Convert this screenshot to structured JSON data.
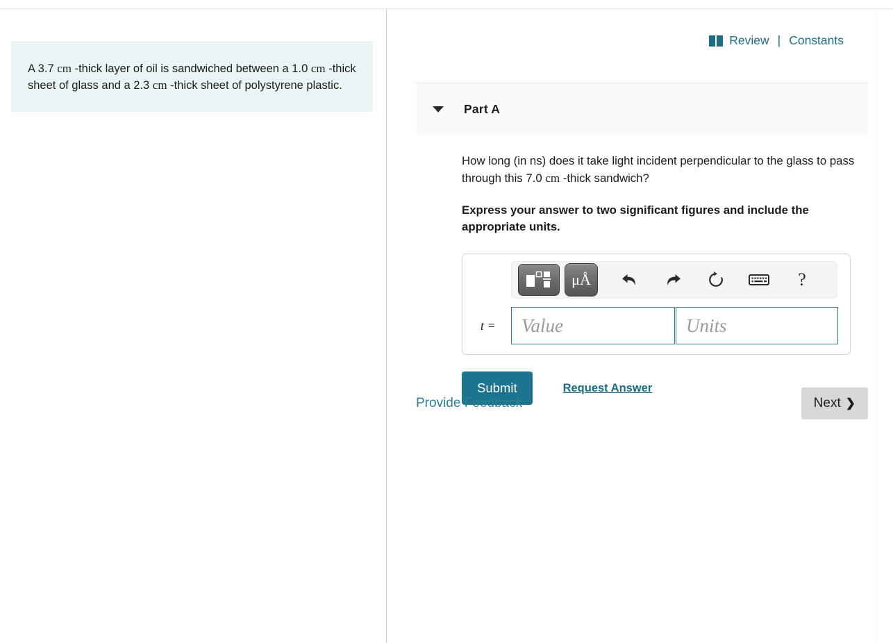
{
  "header": {
    "review_label": "Review",
    "separator": "|",
    "constants_label": "Constants",
    "book_icon": "book-icon",
    "link_color": "#1a6e84"
  },
  "left_pane": {
    "problem_statement": {
      "segment_1": "A 3.7 ",
      "unit_1": "cm",
      "segment_2": " -thick layer of oil is sandwiched between a 1.0 ",
      "unit_2": "cm",
      "segment_3": " -thick sheet of glass and a 2.3 ",
      "unit_3": "cm",
      "segment_4": " -thick sheet of polystyrene plastic.",
      "background_color": "#e9f4f4"
    }
  },
  "part": {
    "title": "Part A",
    "caret_icon": "chevron-down-icon",
    "question_segment_1": "How long (in ns) does it take light incident perpendicular to the glass to pass through this 7.0 ",
    "question_unit": "cm",
    "question_segment_2": " -thick sandwich?",
    "instruction": "Express your answer to two significant figures and include the appropriate units."
  },
  "answer_widget": {
    "template_button_icon": "math-template-icon",
    "unit_button_label": "μÅ",
    "unit_button_icon": "unit-prefix-icon",
    "undo_icon": "undo-icon",
    "redo_icon": "redo-icon",
    "reset_icon": "reset-icon",
    "keyboard_icon": "keyboard-icon",
    "help_icon": "?",
    "variable_label": "t =",
    "value_placeholder": "Value",
    "units_placeholder": "Units",
    "value_current": "",
    "units_current": "",
    "field_border_color": "#2c7f92"
  },
  "actions": {
    "submit_label": "Submit",
    "submit_color": "#1b7591",
    "request_answer_label": "Request Answer"
  },
  "footer": {
    "feedback_label": "Provide Feedback",
    "next_label": "Next",
    "next_chevron": "❯"
  }
}
